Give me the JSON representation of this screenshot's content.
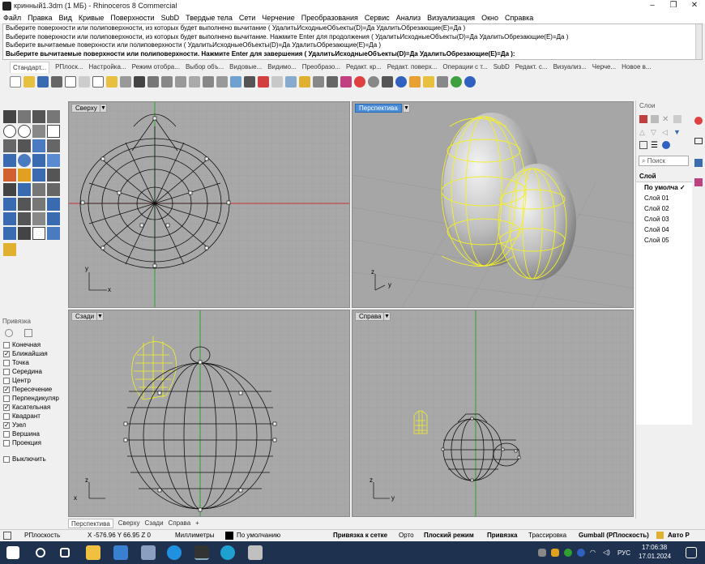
{
  "window": {
    "title": "кринный1.3dm (1 МБ) - Rhinoceros 8 Commercial",
    "minimize": "–",
    "maximize": "❐",
    "close": "✕"
  },
  "menu": [
    "Файл",
    "Правка",
    "Вид",
    "Кривые",
    "Поверхности",
    "SubD",
    "Твердые тела",
    "Сети",
    "Черчение",
    "Преобразования",
    "Сервис",
    "Анализ",
    "Визуализация",
    "Окно",
    "Справка"
  ],
  "command_history": [
    "Выберите поверхности или полиповерхности, из которых будет выполнено вычитание ( УдалитьИсходныеОбъекты(D)=Да  УдалитьОбрезающие(E)=Да )",
    "Выберите поверхности или полиповерхности, из которых будет выполнено вычитание. Нажмите Enter для продолжения ( УдалитьИсходныеОбъекты(D)=Да  УдалитьОбрезающие(E)=Да )",
    "Выберите вычитаемые поверхности или полиповерхности ( УдалитьИсходныеОбъекты(D)=Да  УдалитьОбрезающие(E)=Да )"
  ],
  "command_prompt": "Выберите вычитаемые поверхности или полиповерхности. Нажмите Enter для завершения ( УдалитьИсходныеОбъекты(D)=Да  УдалитьОбрезающие(E)=Да ):",
  "toolbar_tabs": [
    "Стандарт...",
    "РПлоск...",
    "Настройка...",
    "Режим отобра...",
    "Выбор объ...",
    "Видовые...",
    "Видимо...",
    "Преобразо...",
    "Редакт. кр...",
    "Редакт. поверх...",
    "Операции с т...",
    "SubD",
    "Редакт. с...",
    "Визуализ...",
    "Черче...",
    "Новое в..."
  ],
  "viewports": {
    "top": {
      "label": "Сверху"
    },
    "perspective": {
      "label": "Перспектива"
    },
    "back": {
      "label": "Сзади"
    },
    "right": {
      "label": "Справа"
    }
  },
  "axis_labels": {
    "x": "x",
    "y": "y",
    "z": "z"
  },
  "viewport_tabs": [
    "Перспектива",
    "Сверху",
    "Сзади",
    "Справа",
    "+"
  ],
  "osnap": {
    "title": "Привязка",
    "items": [
      {
        "label": "Конечная",
        "checked": false
      },
      {
        "label": "Ближайшая",
        "checked": true
      },
      {
        "label": "Точка",
        "checked": false
      },
      {
        "label": "Середина",
        "checked": false
      },
      {
        "label": "Центр",
        "checked": false
      },
      {
        "label": "Пересечение",
        "checked": true
      },
      {
        "label": "Перпендикуляр",
        "checked": false
      },
      {
        "label": "Касательная",
        "checked": true
      },
      {
        "label": "Квадрант",
        "checked": false
      },
      {
        "label": "Узел",
        "checked": true
      },
      {
        "label": "Вершина",
        "checked": false
      },
      {
        "label": "Проекция",
        "checked": false
      }
    ],
    "disable": "Выключить"
  },
  "layers": {
    "title": "Слои",
    "search_placeholder": "Поиск",
    "column": "Слой",
    "items": [
      "По умолча",
      "Слой 01",
      "Слой 02",
      "Слой 03",
      "Слой 04",
      "Слой 05"
    ],
    "current_mark": "✓"
  },
  "status": {
    "cplane": "РПлоскость",
    "coords": "X -576.96 Y 66.95 Z 0",
    "units": "Миллиметры",
    "layer": "По умолчанию",
    "grid_snap": "Привязка к сетке",
    "ortho": "Орто",
    "planar": "Плоский режим",
    "osnap": "Привязка",
    "smarttrack": "Трассировка",
    "gumball": "Gumball (РПлоскость)",
    "auto": "Авто Р"
  },
  "taskbar": {
    "lang": "РУС",
    "time": "17:06:38",
    "date": "17.01.2024"
  },
  "colors": {
    "viewport_bg": "#a8a8a8",
    "selection_yellow": "#f2f02a",
    "axis_red": "#c83030",
    "axis_green": "#30a030",
    "active_label": "#4a8cd8"
  }
}
